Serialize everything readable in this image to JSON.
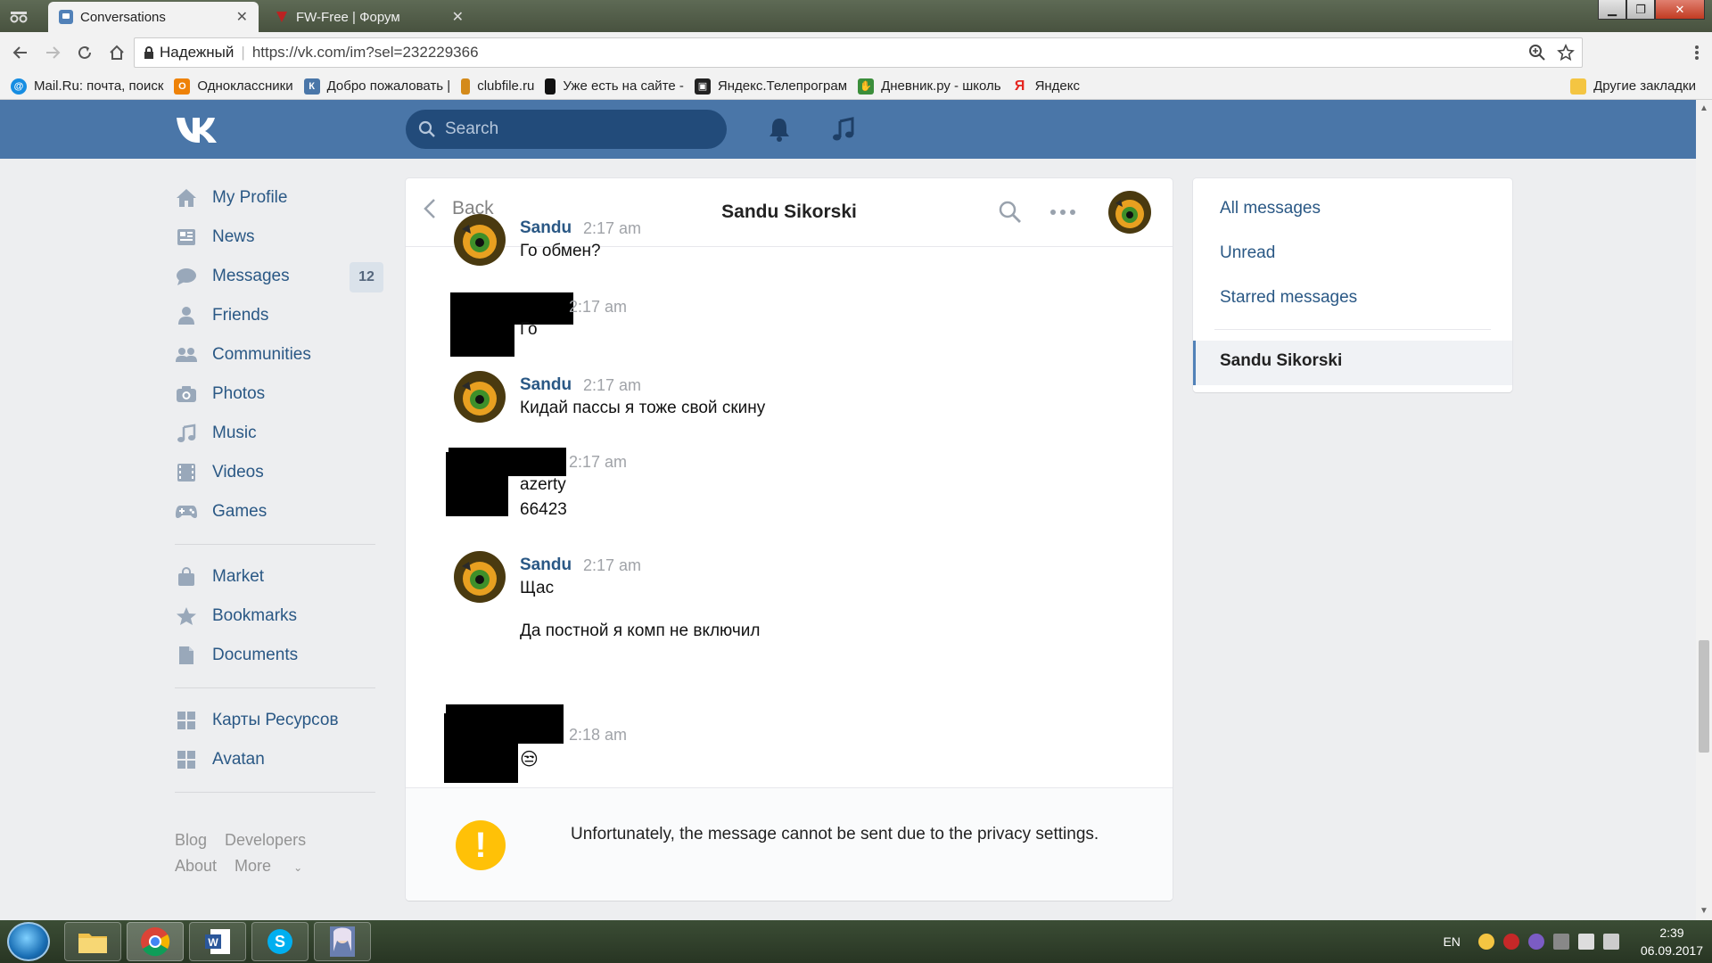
{
  "browser": {
    "tabs": [
      {
        "title": "Conversations",
        "active": true
      },
      {
        "title": "FW-Free | Форум",
        "active": false
      }
    ],
    "secure_label": "Надежный",
    "url": "https://vk.com/im?sel=232229366",
    "bookmarks": [
      {
        "label": "Mail.Ru: почта, поиск",
        "color": "#168de2",
        "icon": "mailru-icon"
      },
      {
        "label": "Одноклассники",
        "color": "#ee8208",
        "icon": "ok-icon"
      },
      {
        "label": "Добро пожаловать |",
        "color": "#4a76a8",
        "icon": "vk-icon"
      },
      {
        "label": "clubfile.ru",
        "color": "#d48a1a",
        "icon": "clubfile-icon"
      },
      {
        "label": "Уже есть на сайте -",
        "color": "#111111",
        "icon": "film-icon"
      },
      {
        "label": "Яндекс.Телепрограм",
        "color": "#222222",
        "icon": "tv-icon"
      },
      {
        "label": "Дневник.ру - школь",
        "color": "#3b8e3b",
        "icon": "hand-icon"
      },
      {
        "label": "Яндекс",
        "color": "#e52620",
        "icon": "yandex-icon"
      }
    ],
    "other_bookmarks": "Другие закладки"
  },
  "vk": {
    "search_placeholder": "Search",
    "nav": [
      {
        "label": "My Profile",
        "icon": "home-icon"
      },
      {
        "label": "News",
        "icon": "news-icon"
      },
      {
        "label": "Messages",
        "icon": "messages-icon",
        "badge": "12"
      },
      {
        "label": "Friends",
        "icon": "friend-icon"
      },
      {
        "label": "Communities",
        "icon": "communities-icon"
      },
      {
        "label": "Photos",
        "icon": "camera-icon"
      },
      {
        "label": "Music",
        "icon": "music-icon"
      },
      {
        "label": "Videos",
        "icon": "video-icon"
      },
      {
        "label": "Games",
        "icon": "gamepad-icon"
      }
    ],
    "nav2": [
      {
        "label": "Market",
        "icon": "bag-icon"
      },
      {
        "label": "Bookmarks",
        "icon": "star-icon"
      },
      {
        "label": "Documents",
        "icon": "document-icon"
      }
    ],
    "nav3": [
      {
        "label": "Карты Ресурсов",
        "icon": "apps-icon"
      },
      {
        "label": "Avatan",
        "icon": "apps-icon"
      }
    ],
    "footer": {
      "blog": "Blog",
      "developers": "Developers",
      "about": "About",
      "more": "More"
    }
  },
  "chat": {
    "back_label": "Back",
    "title": "Sandu Sikorski",
    "messages": [
      {
        "author": "Sandu",
        "time": "2:17 am",
        "lines": [
          "Го обмен?"
        ]
      },
      {
        "author": "",
        "time": "2:17 am",
        "lines": [
          "Го"
        ]
      },
      {
        "author": "Sandu",
        "time": "2:17 am",
        "lines": [
          "Кидай пассы я тоже свой скину"
        ]
      },
      {
        "author": "",
        "time": "2:17 am",
        "lines": [
          "azerty",
          "66423"
        ]
      },
      {
        "author": "Sandu",
        "time": "2:17 am",
        "lines": [
          "Щас",
          "Да постной я комп не включил"
        ]
      },
      {
        "author": "",
        "time": "2:18 am",
        "lines": [
          "😒"
        ]
      }
    ],
    "notice": "Unfortunately, the message cannot be sent due to the privacy settings."
  },
  "right_panel": {
    "all_messages": "All messages",
    "unread": "Unread",
    "starred": "Starred messages",
    "selected": "Sandu Sikorski"
  },
  "taskbar": {
    "lang": "EN",
    "time": "2:39",
    "date": "06.09.2017"
  }
}
